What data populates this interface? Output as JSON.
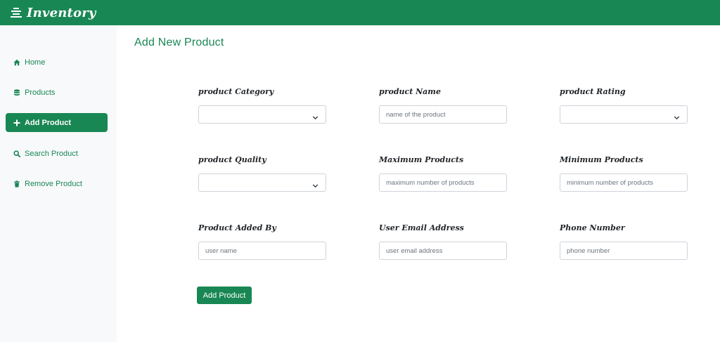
{
  "app": {
    "title": "Inventory",
    "icon": "stack-icon",
    "brand_color": "#198754"
  },
  "sidebar": {
    "items": [
      {
        "label": "Home",
        "icon": "home-icon",
        "active": false
      },
      {
        "label": "Products",
        "icon": "database-icon",
        "active": false
      },
      {
        "label": "Add Product",
        "icon": "plus-icon",
        "active": true
      },
      {
        "label": "Search Product",
        "icon": "search-icon",
        "active": false
      },
      {
        "label": "Remove Product",
        "icon": "trash-icon",
        "active": false
      }
    ]
  },
  "main": {
    "title": "Add New Product",
    "fields": {
      "category": {
        "label": "product Category",
        "type": "select",
        "value": ""
      },
      "name": {
        "label": "product Name",
        "type": "text",
        "placeholder": "name of the product",
        "value": ""
      },
      "rating": {
        "label": "product Rating",
        "type": "select",
        "value": ""
      },
      "quality": {
        "label": "product Quality",
        "type": "select",
        "value": ""
      },
      "max_products": {
        "label": "Maximum Products",
        "type": "text",
        "placeholder": "maximum number of products",
        "value": ""
      },
      "min_products": {
        "label": "Minimum Products",
        "type": "text",
        "placeholder": "minimum number of products",
        "value": ""
      },
      "added_by": {
        "label": "Product Added By",
        "type": "text",
        "placeholder": "user name",
        "value": ""
      },
      "email": {
        "label": "User Email Address",
        "type": "text",
        "placeholder": "user email address",
        "value": ""
      },
      "phone": {
        "label": "Phone Number",
        "type": "text",
        "placeholder": "phone number",
        "value": ""
      }
    },
    "submit_label": "Add Product"
  }
}
